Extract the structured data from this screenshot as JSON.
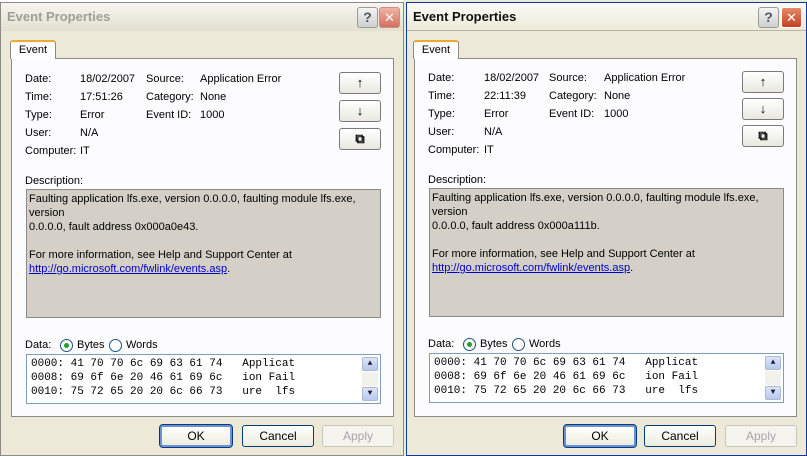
{
  "windows": [
    {
      "title": "Event Properties",
      "tab": "Event",
      "labels": {
        "date": "Date:",
        "time": "Time:",
        "type": "Type:",
        "user": "User:",
        "computer": "Computer:",
        "source": "Source:",
        "category": "Category:",
        "event_id": "Event ID:",
        "description": "Description:",
        "data": "Data:",
        "bytes": "Bytes",
        "words": "Words"
      },
      "date": "18/02/2007",
      "time": "17:51:26",
      "type": "Error",
      "user": "N/A",
      "computer": "IT",
      "source": "Application Error",
      "category": "None",
      "event_id": "1000",
      "desc_line1": "Faulting application lfs.exe, version 0.0.0.0, faulting module lfs.exe, version",
      "desc_line2": "0.0.0.0, fault address 0x000a0e43.",
      "desc_line3": "For more information, see Help and Support Center at",
      "desc_link": "http://go.microsoft.com/fwlink/events.asp",
      "desc_link_tail": ".",
      "hex_rows": [
        "0000: 41 70 70 6c 69 63 61 74   Applicat",
        "0008: 69 6f 6e 20 46 61 69 6c   ion Fail",
        "0010: 75 72 65 20 20 6c 66 73   ure  lfs"
      ],
      "buttons": {
        "ok": "OK",
        "cancel": "Cancel",
        "apply": "Apply"
      },
      "help_glyph": "?",
      "close_glyph": "✕",
      "up_glyph": "↑",
      "down_glyph": "↓",
      "copy_glyph": "⧉"
    },
    {
      "title": "Event Properties",
      "tab": "Event",
      "labels": {
        "date": "Date:",
        "time": "Time:",
        "type": "Type:",
        "user": "User:",
        "computer": "Computer:",
        "source": "Source:",
        "category": "Category:",
        "event_id": "Event ID:",
        "description": "Description:",
        "data": "Data:",
        "bytes": "Bytes",
        "words": "Words"
      },
      "date": "18/02/2007",
      "time": "22:11:39",
      "type": "Error",
      "user": "N/A",
      "computer": "IT",
      "source": "Application Error",
      "category": "None",
      "event_id": "1000",
      "desc_line1": "Faulting application lfs.exe, version 0.0.0.0, faulting module lfs.exe, version",
      "desc_line2": "0.0.0.0, fault address 0x000a111b.",
      "desc_line3": "For more information, see Help and Support Center at",
      "desc_link": "http://go.microsoft.com/fwlink/events.asp",
      "desc_link_tail": ".",
      "hex_rows": [
        "0000: 41 70 70 6c 69 63 61 74   Applicat",
        "0008: 69 6f 6e 20 46 61 69 6c   ion Fail",
        "0010: 75 72 65 20 20 6c 66 73   ure  lfs"
      ],
      "buttons": {
        "ok": "OK",
        "cancel": "Cancel",
        "apply": "Apply"
      },
      "help_glyph": "?",
      "close_glyph": "✕",
      "up_glyph": "↑",
      "down_glyph": "↓",
      "copy_glyph": "⧉"
    }
  ],
  "colors": {
    "link": "#0000cc",
    "tab_accent": "#f0a830",
    "dialog_bg": "#ece9d8"
  }
}
